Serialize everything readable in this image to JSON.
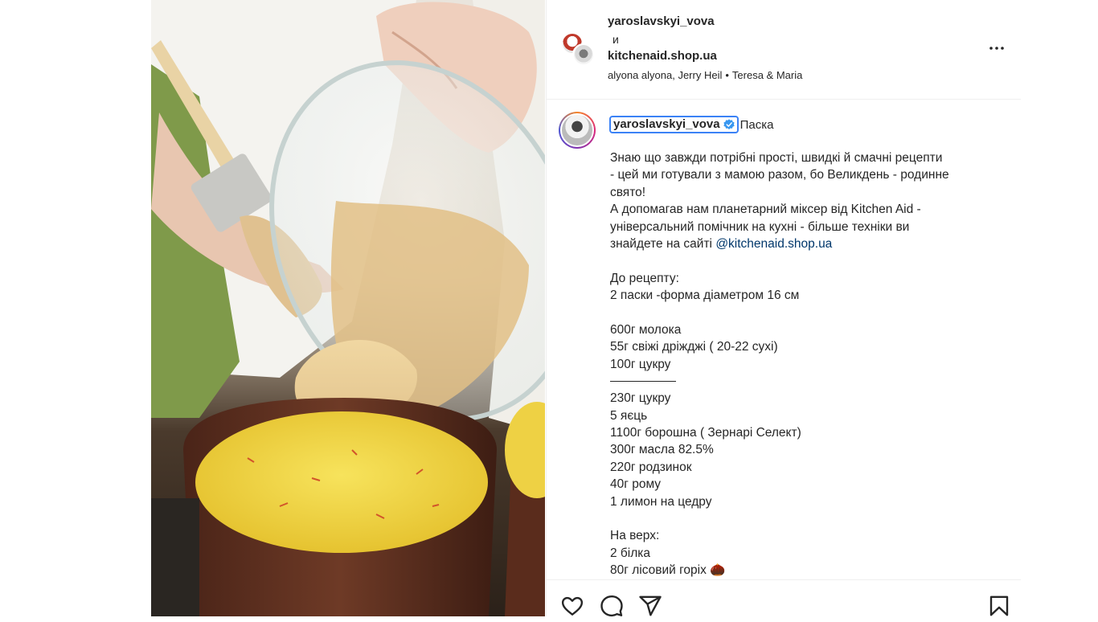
{
  "post": {
    "media_alt": "",
    "header": {
      "user1": "yaroslavskyi_vova",
      "conjunction": "и",
      "user2": "kitchenaid.shop.ua",
      "audio": [
        "alyona alyona, Jerry Heil",
        "•",
        "Teresa & Maria"
      ]
    },
    "caption": {
      "username": "yaroslavskyi_vova",
      "title": "Паска",
      "intro_lines": [
        "Знаю що завжди потрібні прості, швидкі й смачні рецепти",
        "- цей ми готували з мамою разом, бо Великдень - родинне",
        "свято!",
        "А допомагав нам планетарний міксер від Kitchen Aid -",
        "універсальний помічник на кухні - більше техніки ви"
      ],
      "site_prefix": "знайдете на сайті ",
      "site_mention": "@kitchenaid.shop.ua",
      "recipe_header": "До рецепту:",
      "recipe_size": "2 паски -форма діаметром 16 см",
      "group1": [
        "600г молока",
        "55г свіжі дріжджі ( 20-22 сухі)",
        "100г цукру"
      ],
      "group2": [
        "230г цукру",
        "5 яєць",
        "1100г борошна ( Зернарі Селект)",
        "300г масла 82.5%",
        "220г родзинок",
        "40г рому",
        "1 лимон на цедру"
      ],
      "topping_header": "На верх:",
      "topping": [
        "2 білка"
      ],
      "last_line": "80г лісовий горіх",
      "last_emoji": "🌰"
    },
    "icons": [
      "heart-icon",
      "comment-icon",
      "share-icon",
      "bookmark-icon",
      "more-icon",
      "verified-icon"
    ]
  },
  "colors": {
    "text": "#262626",
    "link": "#00376b",
    "verified": "#3897f0",
    "focus": "#3b82f6",
    "border": "#efefef"
  }
}
